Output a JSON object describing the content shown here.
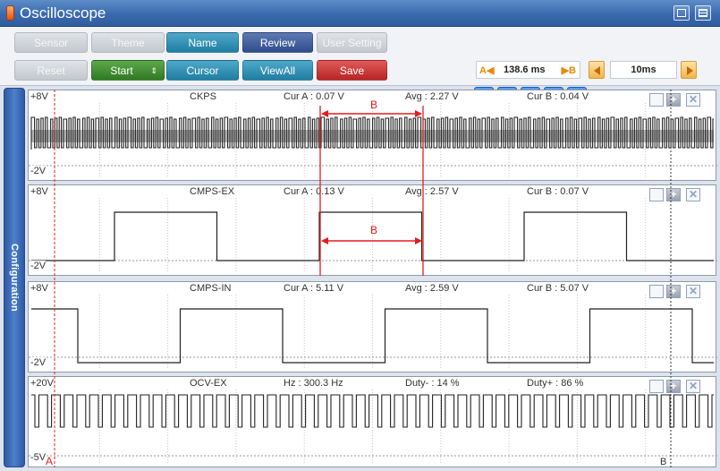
{
  "app": {
    "title": "Oscilloscope"
  },
  "toolbar": {
    "row1": [
      {
        "label": "Sensor",
        "style": "gray"
      },
      {
        "label": "Theme",
        "style": "gray"
      },
      {
        "label": "Name",
        "style": "teal"
      },
      {
        "label": "Review",
        "style": "navy"
      },
      {
        "label": "User Setting",
        "style": "gray"
      }
    ],
    "row2": [
      {
        "label": "Reset",
        "style": "gray"
      },
      {
        "label": "Start",
        "style": "green"
      },
      {
        "label": "Cursor",
        "style": "teal"
      },
      {
        "label": "ViewAll",
        "style": "teal"
      },
      {
        "label": "Save",
        "style": "red"
      }
    ],
    "spin_glyph": "⇕"
  },
  "cursor_readout": {
    "a_label": "A◀",
    "value": "138.6 ms",
    "b_label": "▶B"
  },
  "timebase": {
    "value": "10ms"
  },
  "playback": [
    "skip-start",
    "step-back",
    "stop",
    "play",
    "skip-end"
  ],
  "side_tab": {
    "label": "Configuration"
  },
  "channels": [
    {
      "name": "CKPS",
      "top_mark": "+8V",
      "bottom_mark": "-2V",
      "m1": "Cur A : 0.07 V",
      "m2": "Avg : 2.27 V",
      "m3": "Cur B : 0.04 V",
      "signal": "dense-square",
      "period_ms": 1.1
    },
    {
      "name": "CMPS-EX",
      "top_mark": "+8V",
      "bottom_mark": "-2V",
      "m1": "Cur A : 0.13 V",
      "m2": "Avg : 2.57 V",
      "m3": "Cur B : 0.07 V",
      "signal": "square",
      "period_ms": 53,
      "duty": 0.3
    },
    {
      "name": "CMPS-IN",
      "top_mark": "+8V",
      "bottom_mark": "-2V",
      "m1": "Cur A : 5.11 V",
      "m2": "Avg : 2.59 V",
      "m3": "Cur B : 5.07 V",
      "signal": "square",
      "period_ms": 53,
      "duty": 0.5
    },
    {
      "name": "OCV-EX",
      "top_mark": "+20V",
      "bottom_mark": "-5V",
      "m1": "Hz : 300.3 Hz",
      "m2": "Duty- : 14 %",
      "m3": "Duty+ : 86 %",
      "signal": "pulse",
      "period_ms": 3.3,
      "duty": 0.14
    }
  ],
  "cursor_markers": {
    "a": "A",
    "b": "B",
    "interval_label": "B"
  },
  "colors": {
    "titlebar": "#3a6aae",
    "cursor": "#e51c1c",
    "trace": "#222222",
    "accent_orange": "#e8880c",
    "playback_blue": "#1f66cc"
  }
}
